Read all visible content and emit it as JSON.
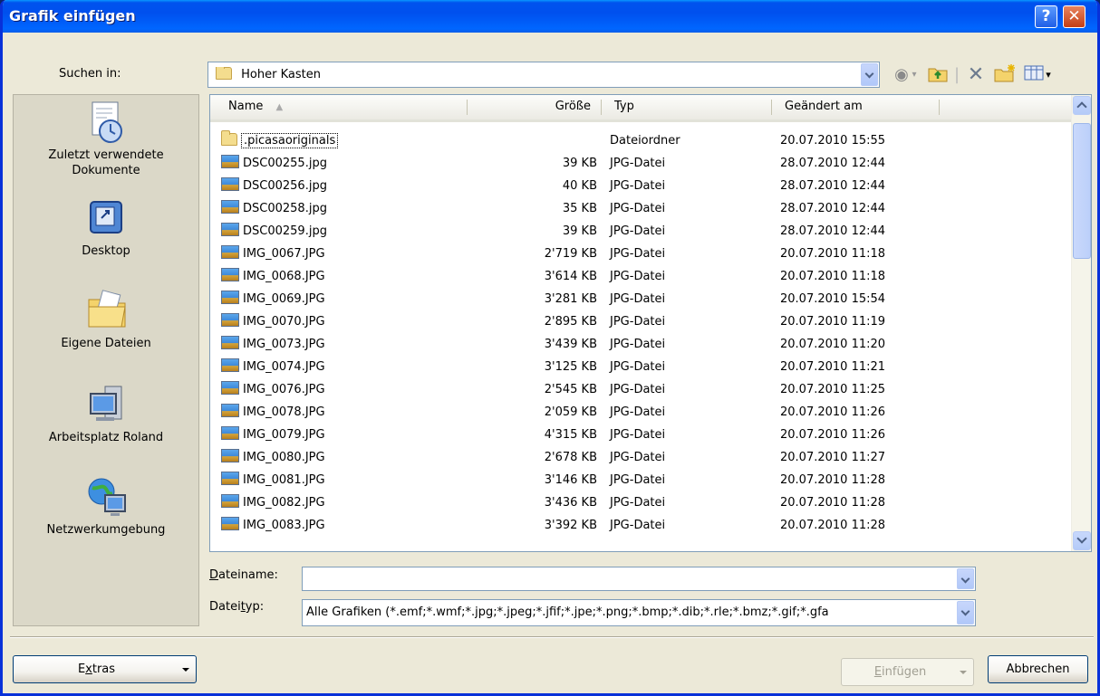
{
  "title": "Grafik einfügen",
  "titlebar": {
    "help_label": "?",
    "close_label": "✕"
  },
  "look_in": {
    "label": "Suchen in:",
    "value": "Hoher Kasten"
  },
  "toolbar": {
    "icons": [
      "back-icon",
      "up-folder-icon",
      "delete-icon",
      "new-folder-icon",
      "views-icon"
    ]
  },
  "places": [
    {
      "id": "recent",
      "label": "Zuletzt verwendete Dokumente",
      "icon": "recent-documents-icon"
    },
    {
      "id": "desktop",
      "label": "Desktop",
      "icon": "desktop-icon"
    },
    {
      "id": "my-documents",
      "label": "Eigene Dateien",
      "icon": "my-documents-icon"
    },
    {
      "id": "my-computer",
      "label": "Arbeitsplatz Roland",
      "icon": "my-computer-icon"
    },
    {
      "id": "network",
      "label": "Netzwerkumgebung",
      "icon": "network-icon"
    }
  ],
  "columns": {
    "name": "Name",
    "size": "Größe",
    "type": "Typ",
    "modified": "Geändert am"
  },
  "files": [
    {
      "name": ".picasaoriginals",
      "size": "",
      "type": "Dateiordner",
      "modified": "20.07.2010 15:55",
      "kind": "folder"
    },
    {
      "name": "DSC00255.jpg",
      "size": "39 KB",
      "type": "JPG-Datei",
      "modified": "28.07.2010 12:44",
      "kind": "image"
    },
    {
      "name": "DSC00256.jpg",
      "size": "40 KB",
      "type": "JPG-Datei",
      "modified": "28.07.2010 12:44",
      "kind": "image"
    },
    {
      "name": "DSC00258.jpg",
      "size": "35 KB",
      "type": "JPG-Datei",
      "modified": "28.07.2010 12:44",
      "kind": "image"
    },
    {
      "name": "DSC00259.jpg",
      "size": "39 KB",
      "type": "JPG-Datei",
      "modified": "28.07.2010 12:44",
      "kind": "image"
    },
    {
      "name": "IMG_0067.JPG",
      "size": "2'719 KB",
      "type": "JPG-Datei",
      "modified": "20.07.2010 11:18",
      "kind": "image"
    },
    {
      "name": "IMG_0068.JPG",
      "size": "3'614 KB",
      "type": "JPG-Datei",
      "modified": "20.07.2010 11:18",
      "kind": "image"
    },
    {
      "name": "IMG_0069.JPG",
      "size": "3'281 KB",
      "type": "JPG-Datei",
      "modified": "20.07.2010 15:54",
      "kind": "image"
    },
    {
      "name": "IMG_0070.JPG",
      "size": "2'895 KB",
      "type": "JPG-Datei",
      "modified": "20.07.2010 11:19",
      "kind": "image"
    },
    {
      "name": "IMG_0073.JPG",
      "size": "3'439 KB",
      "type": "JPG-Datei",
      "modified": "20.07.2010 11:20",
      "kind": "image"
    },
    {
      "name": "IMG_0074.JPG",
      "size": "3'125 KB",
      "type": "JPG-Datei",
      "modified": "20.07.2010 11:21",
      "kind": "image"
    },
    {
      "name": "IMG_0076.JPG",
      "size": "2'545 KB",
      "type": "JPG-Datei",
      "modified": "20.07.2010 11:25",
      "kind": "image"
    },
    {
      "name": "IMG_0078.JPG",
      "size": "2'059 KB",
      "type": "JPG-Datei",
      "modified": "20.07.2010 11:26",
      "kind": "image"
    },
    {
      "name": "IMG_0079.JPG",
      "size": "4'315 KB",
      "type": "JPG-Datei",
      "modified": "20.07.2010 11:26",
      "kind": "image"
    },
    {
      "name": "IMG_0080.JPG",
      "size": "2'678 KB",
      "type": "JPG-Datei",
      "modified": "20.07.2010 11:27",
      "kind": "image"
    },
    {
      "name": "IMG_0081.JPG",
      "size": "3'146 KB",
      "type": "JPG-Datei",
      "modified": "20.07.2010 11:28",
      "kind": "image"
    },
    {
      "name": "IMG_0082.JPG",
      "size": "3'436 KB",
      "type": "JPG-Datei",
      "modified": "20.07.2010 11:28",
      "kind": "image"
    },
    {
      "name": "IMG_0083.JPG",
      "size": "3'392 KB",
      "type": "JPG-Datei",
      "modified": "20.07.2010 11:28",
      "kind": "image"
    }
  ],
  "filename": {
    "label_pre": "",
    "label_key": "D",
    "label_post": "ateiname:",
    "value": ""
  },
  "filetype": {
    "label_pre": "Datei",
    "label_key": "t",
    "label_post": "yp:",
    "value": "Alle Grafiken (*.emf;*.wmf;*.jpg;*.jpeg;*.jfif;*.jpe;*.png;*.bmp;*.dib;*.rle;*.bmz;*.gif;*.gfa"
  },
  "buttons": {
    "extras_pre": "E",
    "extras_key": "x",
    "extras_post": "tras",
    "insert_key": "E",
    "insert_post": "infügen",
    "cancel": "Abbrechen"
  }
}
